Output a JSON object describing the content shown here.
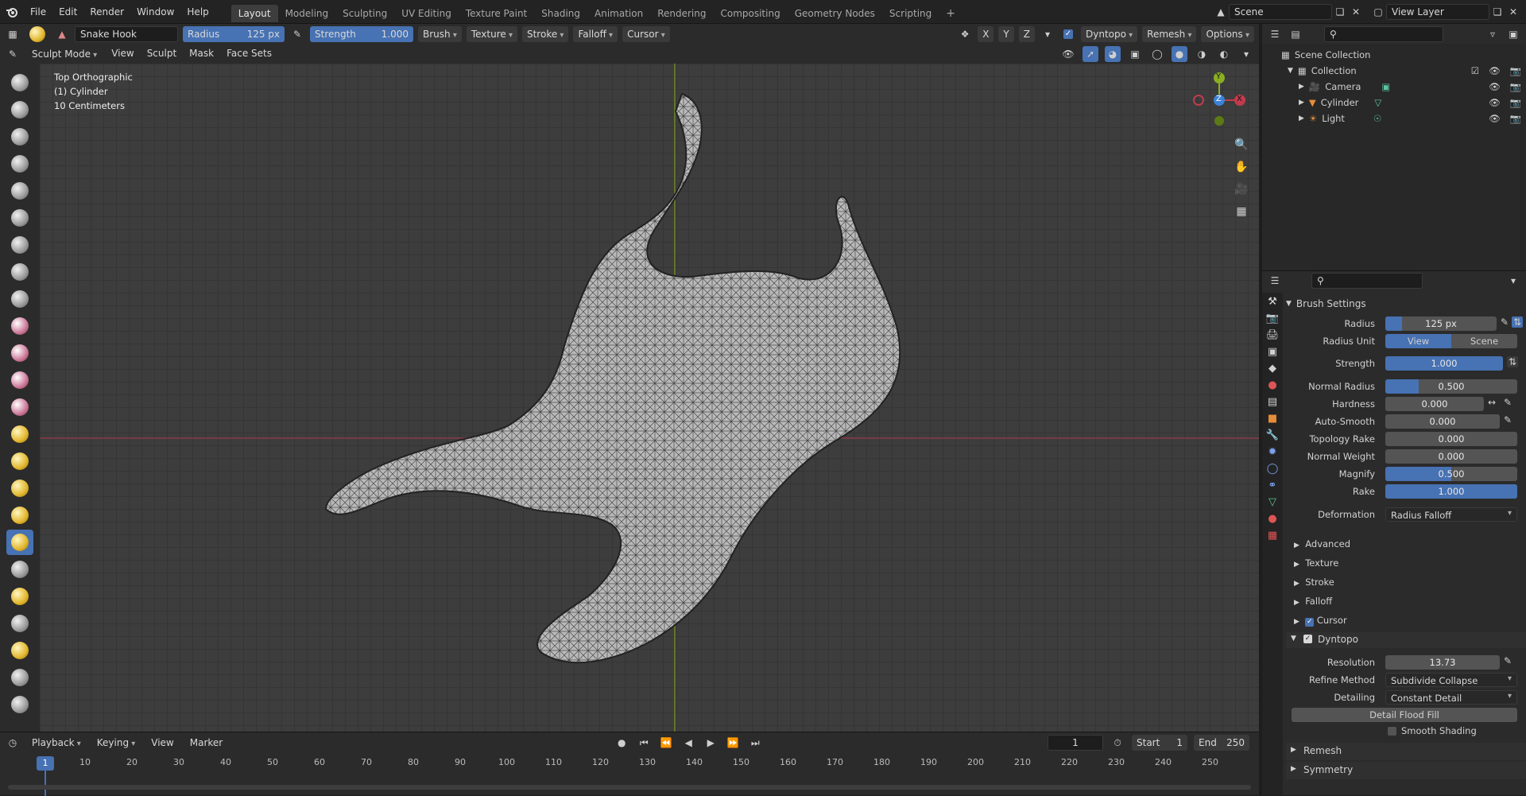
{
  "menu": [
    "File",
    "Edit",
    "Render",
    "Window",
    "Help"
  ],
  "workspaces": [
    "Layout",
    "Modeling",
    "Sculpting",
    "UV Editing",
    "Texture Paint",
    "Shading",
    "Animation",
    "Rendering",
    "Compositing",
    "Geometry Nodes",
    "Scripting"
  ],
  "active_workspace": "Layout",
  "scene_name": "Scene",
  "view_layer": "View Layer",
  "tool_header": {
    "brush_name": "Snake Hook",
    "radius_label": "Radius",
    "radius_value": "125 px",
    "strength_label": "Strength",
    "strength_value": "1.000",
    "menus": [
      "Brush",
      "Texture",
      "Stroke",
      "Falloff",
      "Cursor"
    ],
    "axis": [
      "X",
      "Y",
      "Z"
    ],
    "dyntopo": "Dyntopo",
    "remesh": "Remesh",
    "options": "Options"
  },
  "mode_header": {
    "mode": "Sculpt Mode",
    "menus": [
      "View",
      "Sculpt",
      "Mask",
      "Face Sets"
    ]
  },
  "viewport": {
    "view_name": "Top Orthographic",
    "object": "(1) Cylinder",
    "scale": "10 Centimeters",
    "gizmo": {
      "x": "X",
      "y": "Y",
      "z": "Z"
    }
  },
  "outliner": {
    "root": "Scene Collection",
    "collection": "Collection",
    "items": [
      {
        "name": "Camera",
        "color": "#e58d3a"
      },
      {
        "name": "Cylinder",
        "color": "#e58d3a"
      },
      {
        "name": "Light",
        "color": "#e58d3a"
      }
    ]
  },
  "brush_settings": {
    "title": "Brush Settings",
    "radius": {
      "label": "Radius",
      "value": "125 px",
      "fill": 0.15
    },
    "radius_unit": {
      "label": "Radius Unit",
      "options": [
        "View",
        "Scene"
      ],
      "selected": "View"
    },
    "strength": {
      "label": "Strength",
      "value": "1.000",
      "fill": 1.0
    },
    "normal_radius": {
      "label": "Normal Radius",
      "value": "0.500",
      "fill": 0.25
    },
    "hardness": {
      "label": "Hardness",
      "value": "0.000"
    },
    "auto_smooth": {
      "label": "Auto-Smooth",
      "value": "0.000"
    },
    "topology_rake": {
      "label": "Topology Rake",
      "value": "0.000"
    },
    "normal_weight": {
      "label": "Normal Weight",
      "value": "0.000"
    },
    "magnify": {
      "label": "Magnify",
      "value": "0.500",
      "fill": 0.5
    },
    "rake": {
      "label": "Rake",
      "value": "1.000",
      "fill": 1.0
    },
    "deformation": {
      "label": "Deformation",
      "value": "Radius Falloff"
    },
    "subpanels": [
      "Advanced",
      "Texture",
      "Stroke",
      "Falloff"
    ],
    "cursor": "Cursor"
  },
  "dyntopo": {
    "title": "Dyntopo",
    "resolution": {
      "label": "Resolution",
      "value": "13.73"
    },
    "refine": {
      "label": "Refine Method",
      "value": "Subdivide Collapse"
    },
    "detailing": {
      "label": "Detailing",
      "value": "Constant Detail"
    },
    "flood_fill": "Detail Flood Fill",
    "smooth_shading": "Smooth Shading"
  },
  "more_panels": [
    "Remesh",
    "Symmetry"
  ],
  "timeline": {
    "menus": [
      "Playback",
      "Keying",
      "View",
      "Marker"
    ],
    "current_frame": "1",
    "start_label": "Start",
    "start": "1",
    "end_label": "End",
    "end": "250",
    "ticks": [
      "1",
      "10",
      "20",
      "30",
      "40",
      "50",
      "60",
      "70",
      "80",
      "90",
      "100",
      "110",
      "120",
      "130",
      "140",
      "150",
      "160",
      "170",
      "180",
      "190",
      "200",
      "210",
      "220",
      "230",
      "240",
      "250"
    ]
  }
}
